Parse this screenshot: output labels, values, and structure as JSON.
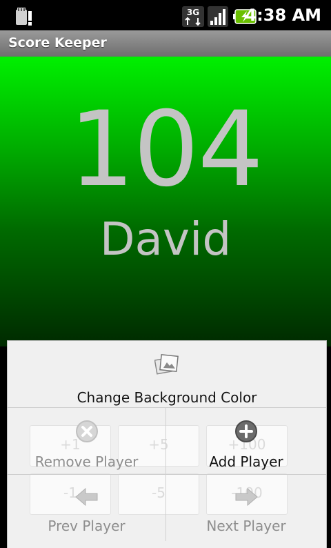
{
  "status_bar": {
    "time": "4:38 AM",
    "network": "3G"
  },
  "app": {
    "title": "Score Keeper"
  },
  "score": {
    "value": "104",
    "player": "David",
    "background_color": "#00c000"
  },
  "ghost_buttons": [
    "+1",
    "+5",
    "+100",
    "-1",
    "-5",
    "-100"
  ],
  "menu": {
    "change_bg": {
      "label": "Change Background Color",
      "icon": "picture-icon"
    },
    "remove_player": {
      "label": "Remove Player",
      "icon": "remove-icon",
      "enabled": false
    },
    "add_player": {
      "label": "Add Player",
      "icon": "add-icon",
      "enabled": true
    },
    "prev_player": {
      "label": "Prev Player",
      "icon": "arrow-left-icon",
      "enabled": false
    },
    "next_player": {
      "label": "Next Player",
      "icon": "arrow-right-icon",
      "enabled": false
    }
  }
}
